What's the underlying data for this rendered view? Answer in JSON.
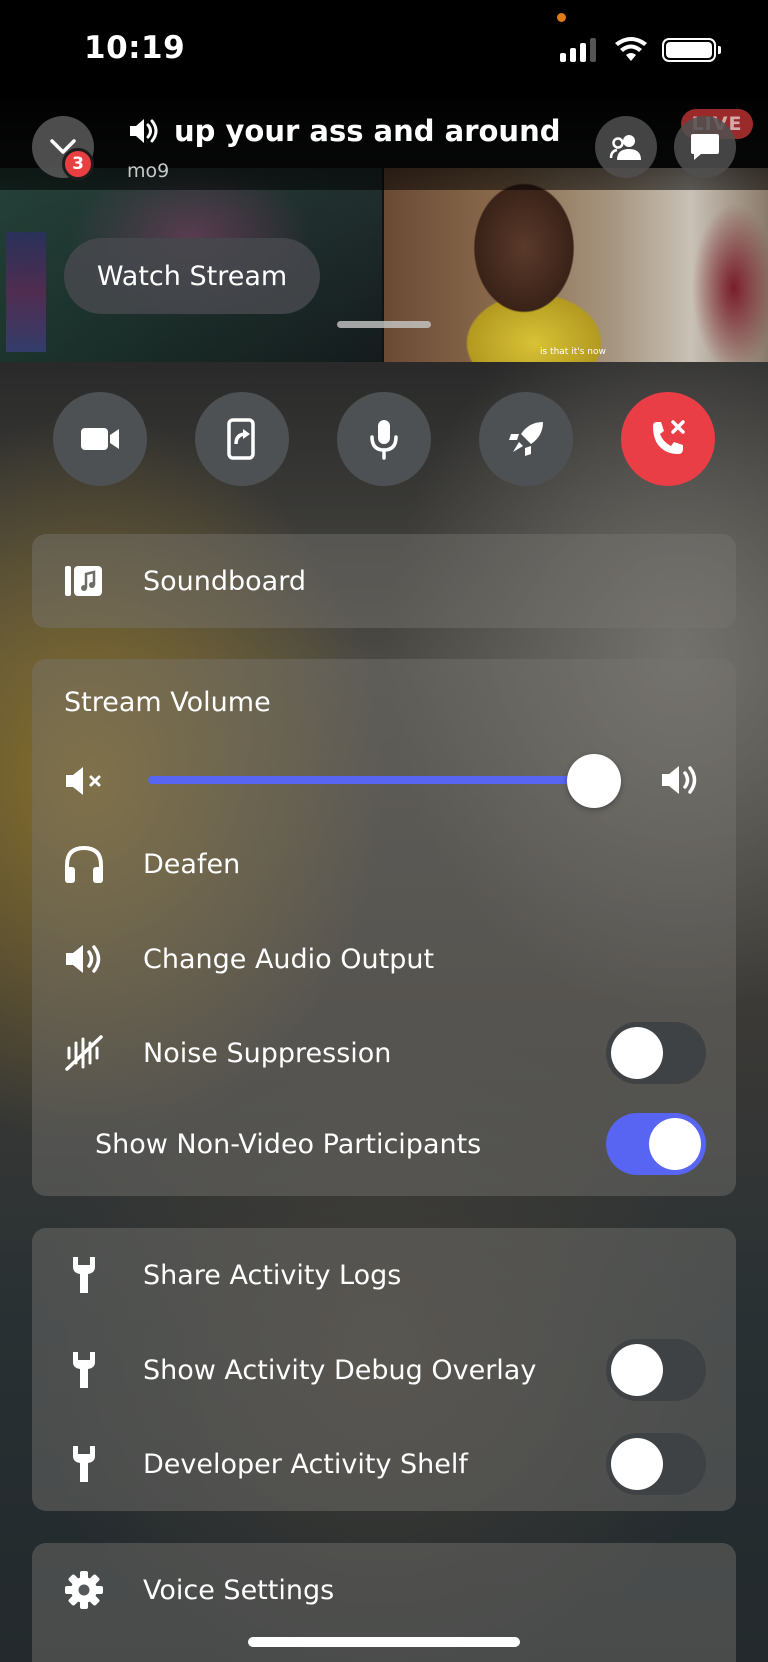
{
  "status_bar": {
    "time": "10:19"
  },
  "header": {
    "channel_name": "up your ass and around",
    "server_name": "mo9",
    "notification_count": "3",
    "live_label": "LIVE"
  },
  "stream": {
    "watch_button": "Watch Stream",
    "subtitle": "is that it's now"
  },
  "controls": [
    {
      "name": "camera",
      "icon": "video-camera-icon"
    },
    {
      "name": "screen-share",
      "icon": "share-screen-icon"
    },
    {
      "name": "microphone",
      "icon": "microphone-icon"
    },
    {
      "name": "activities",
      "icon": "rocket-icon"
    },
    {
      "name": "leave-call",
      "icon": "phone-x-icon",
      "color": "#e93e45"
    }
  ],
  "soundboard": {
    "label": "Soundboard"
  },
  "volume": {
    "title": "Stream Volume",
    "level": 0.93,
    "accent": "#5865f2"
  },
  "audio_options": {
    "deafen": "Deafen",
    "change_output": "Change Audio Output",
    "noise_suppression": "Noise Suppression",
    "noise_suppression_on": false,
    "show_non_video": "Show Non-Video Participants",
    "show_non_video_on": true
  },
  "developer": {
    "share_logs": "Share Activity Logs",
    "debug_overlay": "Show Activity Debug Overlay",
    "debug_overlay_on": false,
    "activity_shelf": "Developer Activity Shelf",
    "activity_shelf_on": false
  },
  "voice_settings": {
    "label": "Voice Settings"
  }
}
